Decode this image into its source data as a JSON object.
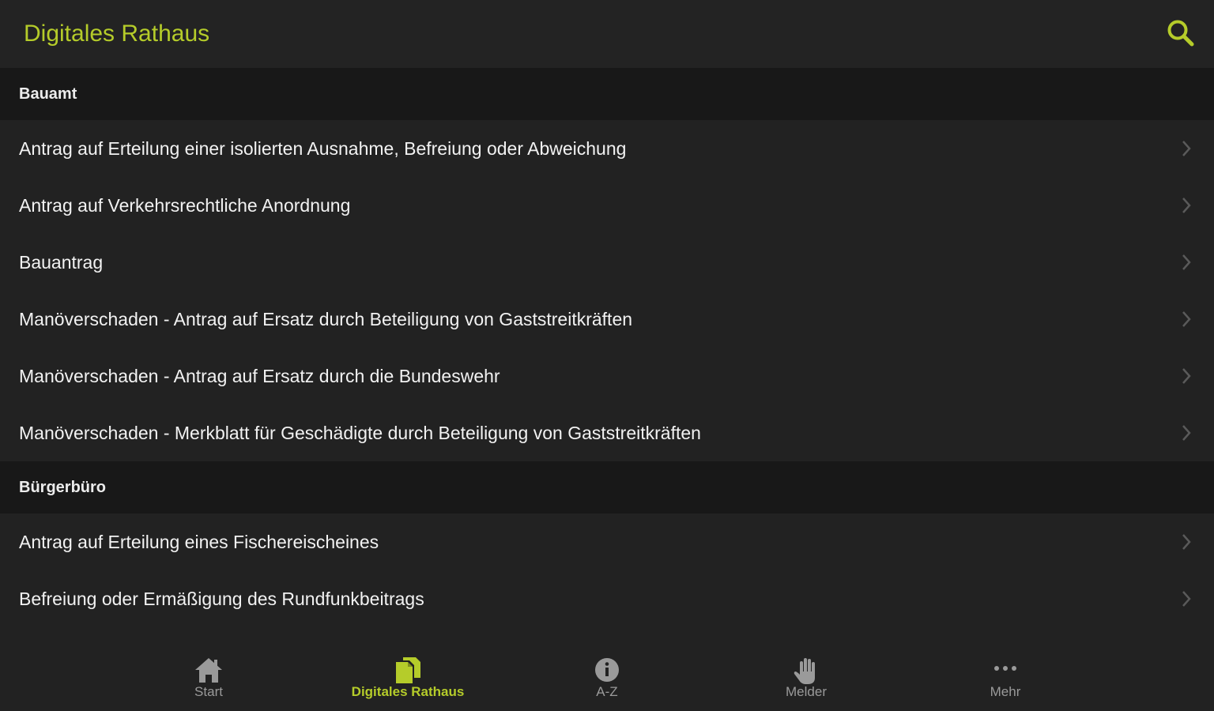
{
  "header": {
    "title": "Digitales Rathaus",
    "search_icon": "search-icon",
    "accent_color": "#b5cc2a"
  },
  "sections": [
    {
      "title": "Bauamt",
      "items": [
        {
          "label": "Antrag auf Erteilung einer isolierten Ausnahme, Befreiung oder Abweichung"
        },
        {
          "label": "Antrag auf Verkehrsrechtliche Anordnung"
        },
        {
          "label": "Bauantrag"
        },
        {
          "label": "Manöverschaden - Antrag auf Ersatz durch Beteiligung von Gaststreitkräften"
        },
        {
          "label": "Manöverschaden - Antrag auf Ersatz durch die Bundeswehr"
        },
        {
          "label": "Manöverschaden - Merkblatt für Geschädigte durch Beteiligung von Gaststreitkräften"
        }
      ]
    },
    {
      "title": "Bürgerbüro",
      "items": [
        {
          "label": "Antrag auf Erteilung eines Fischereischeines"
        },
        {
          "label": "Befreiung oder Ermäßigung des Rundfunkbeitrags"
        }
      ]
    }
  ],
  "bottom_nav": {
    "active_index": 1,
    "items": [
      {
        "label": "Start",
        "icon": "home-icon"
      },
      {
        "label": "Digitales Rathaus",
        "icon": "documents-icon"
      },
      {
        "label": "A-Z",
        "icon": "info-icon"
      },
      {
        "label": "Melder",
        "icon": "hand-icon"
      },
      {
        "label": "Mehr",
        "icon": "more-icon"
      }
    ]
  }
}
